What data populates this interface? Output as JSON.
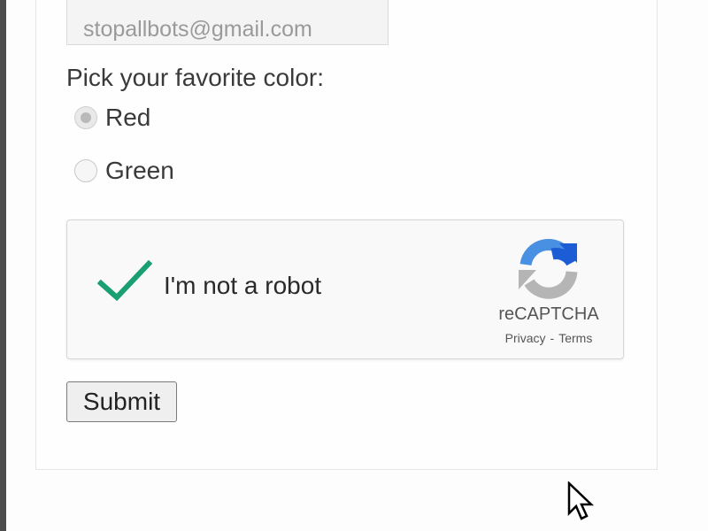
{
  "form": {
    "email_value": "stopallbots@gmail.com",
    "color_question": "Pick your favorite color:",
    "radio_options": [
      {
        "label": "Red",
        "checked": true
      },
      {
        "label": "Green",
        "checked": false
      }
    ]
  },
  "recaptcha": {
    "checkbox_label": "I'm not a robot",
    "checked": true,
    "brand": "reCAPTCHA",
    "privacy_link": "Privacy",
    "separator": "-",
    "terms_link": "Terms",
    "check_color": "#1a9f72",
    "logo_blue": "#1c5dd6",
    "logo_light_blue": "#4a90e2",
    "logo_gray": "#b5b5b5"
  },
  "submit": {
    "label": "Submit"
  },
  "icons": {
    "cursor": "mouse-pointer-icon",
    "check": "checkmark-icon",
    "recaptcha_logo": "recaptcha-logo-icon"
  }
}
